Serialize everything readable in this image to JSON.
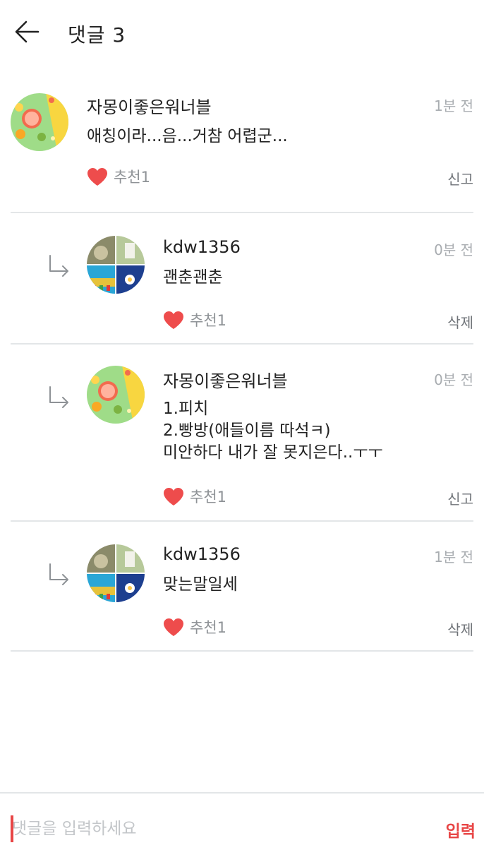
{
  "header": {
    "title": "댓글 3"
  },
  "comments": [
    {
      "author": "자몽이좋은워너블",
      "time": "1분 전",
      "text": "애칭이라...음...거참 어렵군...",
      "like_label": "추천1",
      "action": "신고",
      "is_reply": false,
      "avatar": "grapefruit-avatar"
    },
    {
      "author": "kdw1356",
      "time": "0분 전",
      "text": "괜춘괜춘",
      "like_label": "추천1",
      "action": "삭제",
      "is_reply": true,
      "avatar": "collage-avatar"
    },
    {
      "author": "자몽이좋은워너블",
      "time": "0분 전",
      "text": "1.피치\n2.빵방(애들이름 따석ㅋ)\n미안하다 내가 잘 못지은다..ㅜㅜ",
      "like_label": "추천1",
      "action": "신고",
      "is_reply": true,
      "avatar": "grapefruit-avatar"
    },
    {
      "author": "kdw1356",
      "time": "1분 전",
      "text": "맞는말일세",
      "like_label": "추천1",
      "action": "삭제",
      "is_reply": true,
      "avatar": "collage-avatar"
    }
  ],
  "input": {
    "placeholder": "댓글을 입력하세요",
    "value": "",
    "submit_label": "입력"
  },
  "colors": {
    "accent": "#e84646",
    "heart": "#ee4c4c",
    "divider": "#e3e6e8",
    "muted": "#a9adb1"
  }
}
